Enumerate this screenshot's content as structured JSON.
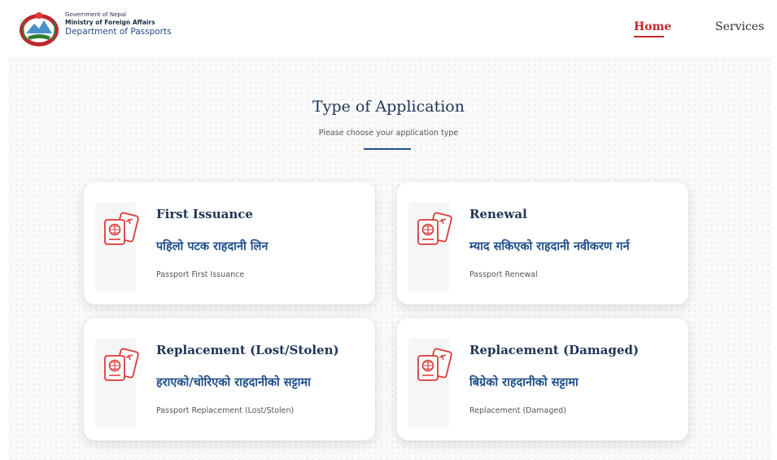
{
  "header": {
    "org_line1": "Government of Nepal",
    "org_line2": "Ministry of Foreign Affairs",
    "org_line3": "Department of Passports",
    "nav": {
      "home": "Home",
      "services": "Services"
    },
    "active_color": "#c1272d"
  },
  "page": {
    "title": "Type of Application",
    "subtitle": "Please choose your application type"
  },
  "cards": [
    {
      "title": "First Issuance",
      "nepali": "पहिलो पटक राहदानी लिन",
      "description": "Passport First Issuance",
      "icon": "passport-icon"
    },
    {
      "title": "Renewal",
      "nepali": "म्याद सकिएको राहदानी नवीकरण गर्न",
      "description": "Passport Renewal",
      "icon": "passport-icon"
    },
    {
      "title": "Replacement (Lost/Stolen)",
      "nepali": "हराएको/चोरिएको राहदानीको सट्टामा",
      "description": "Passport Replacement (Lost/Stolen)",
      "icon": "passport-icon"
    },
    {
      "title": "Replacement (Damaged)",
      "nepali": "बिग्रेको राहदानीको सट्टामा",
      "description": "Replacement (Damaged)",
      "icon": "passport-icon"
    }
  ],
  "colors": {
    "primary": "#1f3556",
    "accent_blue": "#1f4e8c",
    "icon_red": "#d93a3a"
  }
}
